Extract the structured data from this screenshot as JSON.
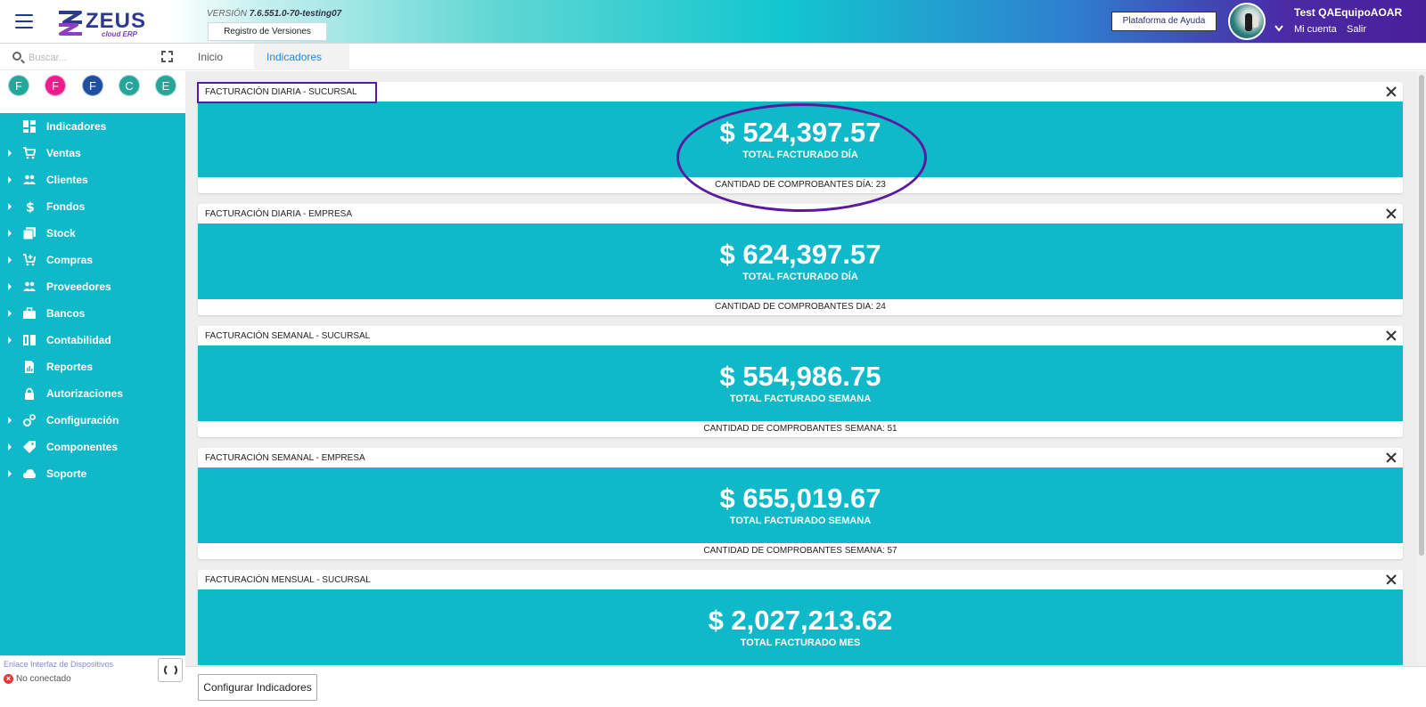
{
  "header": {
    "version_label": "VERSIÓN",
    "version_value": "7.6.551.0-70-testing07",
    "registro_button": "Registro de Versiones",
    "help_button": "Plataforma de Ayuda",
    "user_name": "Test QAEquipoAOAR",
    "mi_cuenta": "Mi cuenta",
    "salir": "Salir",
    "logo_text": "ZEUS",
    "logo_sub": "cloud ERP"
  },
  "sidebar": {
    "search_placeholder": "Buscar...",
    "favorites": [
      {
        "letter": "F",
        "color": "#26a69a"
      },
      {
        "letter": "F",
        "color": "#e91e8c"
      },
      {
        "letter": "F",
        "color": "#1e4fa0"
      },
      {
        "letter": "C",
        "color": "#26a69a"
      },
      {
        "letter": "E",
        "color": "#26a69a"
      }
    ],
    "items": [
      {
        "label": "Indicadores",
        "icon": "dashboard-icon",
        "expandable": false
      },
      {
        "label": "Ventas",
        "icon": "cart-icon",
        "expandable": true
      },
      {
        "label": "Clientes",
        "icon": "people-icon",
        "expandable": true
      },
      {
        "label": "Fondos",
        "icon": "dollar-icon",
        "expandable": true
      },
      {
        "label": "Stock",
        "icon": "stack-icon",
        "expandable": true
      },
      {
        "label": "Compras",
        "icon": "cart-add-icon",
        "expandable": true
      },
      {
        "label": "Proveedores",
        "icon": "people-icon",
        "expandable": true
      },
      {
        "label": "Bancos",
        "icon": "briefcase-icon",
        "expandable": true
      },
      {
        "label": "Contabilidad",
        "icon": "book-icon",
        "expandable": true
      },
      {
        "label": "Reportes",
        "icon": "report-icon",
        "expandable": false
      },
      {
        "label": "Autorizaciones",
        "icon": "lock-icon",
        "expandable": false
      },
      {
        "label": "Configuración",
        "icon": "gears-icon",
        "expandable": true
      },
      {
        "label": "Componentes",
        "icon": "tag-icon",
        "expandable": true
      },
      {
        "label": "Soporte",
        "icon": "cloud-icon",
        "expandable": true
      }
    ],
    "footer_link": "Enlace Interfaz de Dispositivos",
    "footer_status": "No conectado"
  },
  "tabs": [
    {
      "label": "Inicio"
    },
    {
      "label": "Indicadores"
    }
  ],
  "cards": [
    {
      "title": "FACTURACIÓN DIARIA - SUCURSAL",
      "value": "$ 524,397.57",
      "label": "TOTAL FACTURADO DÍA",
      "foot": "CANTIDAD DE COMPROBANTES DÍA: 23"
    },
    {
      "title": "FACTURACIÓN DIARIA - EMPRESA",
      "value": "$ 624,397.57",
      "label": "TOTAL FACTURADO DÍA",
      "foot": "CANTIDAD DE COMPROBANTES DIA: 24"
    },
    {
      "title": "FACTURACIÓN SEMANAL - SUCURSAL",
      "value": "$ 554,986.75",
      "label": "TOTAL FACTURADO SEMANA",
      "foot": "CANTIDAD DE COMPROBANTES SEMANA: 51"
    },
    {
      "title": "FACTURACIÓN SEMANAL - EMPRESA",
      "value": "$ 655,019.67",
      "label": "TOTAL FACTURADO SEMANA",
      "foot": "CANTIDAD DE COMPROBANTES SEMANA: 57"
    },
    {
      "title": "FACTURACIÓN MENSUAL - SUCURSAL",
      "value": "$ 2,027,213.62",
      "label": "TOTAL FACTURADO MES",
      "foot": ""
    }
  ],
  "config_button": "Configurar Indicadores",
  "colors": {
    "accent": "#0fb9c9",
    "highlight": "#5a1aa0"
  }
}
